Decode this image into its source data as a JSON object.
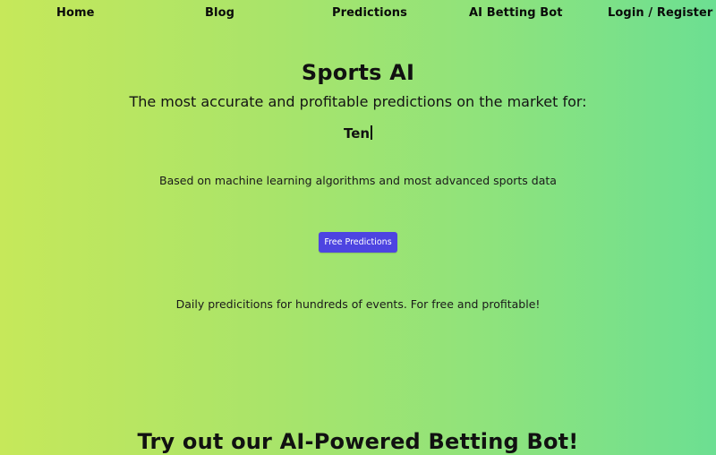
{
  "nav": {
    "items": [
      {
        "label": "Home"
      },
      {
        "label": "Blog"
      },
      {
        "label": "Predictions"
      },
      {
        "label": "AI Betting Bot"
      },
      {
        "label": "Login / Register"
      }
    ]
  },
  "hero": {
    "title": "Sports AI",
    "subtitle": "The most accurate and profitable predictions on the market for:",
    "typed_text": "Ten",
    "basis": "Based on machine learning algorithms and most advanced sports data",
    "cta_label": "Free Predictions",
    "daily": "Daily predicitions for hundreds of events. For free and profitable!"
  },
  "bot_section": {
    "heading": "Try out our AI-Powered Betting Bot!"
  },
  "colors": {
    "gradient_left": "#c6e85a",
    "gradient_right": "#6cdf92",
    "cta_background": "#4d44e1",
    "text": "#111111"
  }
}
